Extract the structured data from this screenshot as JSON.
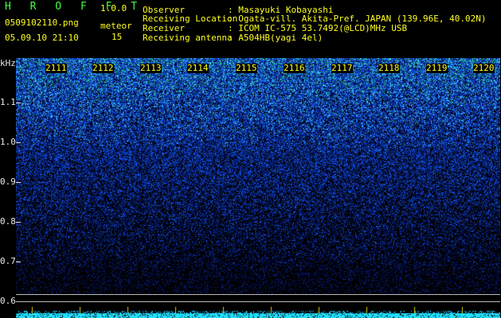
{
  "app": {
    "title": "H R O F F T",
    "version": "1.0.0",
    "filename": "0509102110.png",
    "datetime": "05.09.10 21:10",
    "count_label": "meteor",
    "count_value": "15"
  },
  "info": {
    "observer_label": "Observer",
    "observer_value": ": Masayuki Kobayashi",
    "location_label": "Receiving Location",
    "location_value": ": Ogata-vill. Akita-Pref. JAPAN (139.96E, 40.02N)",
    "receiver_label": "Receiver",
    "receiver_value": ": ICOM IC-575 53.7492(@LCD)MHz USB",
    "antenna_label": "Receiving antenna",
    "antenna_value": ": A504HB(yagi 4el)"
  },
  "spectrogram": {
    "y_unit": "kHz",
    "y_ticks": [
      "1.1",
      "1.0",
      "0.9",
      "0.8",
      "0.7",
      "0.6"
    ],
    "x_ticks": [
      "2111",
      "2112",
      "2113",
      "2114",
      "2115",
      "2116",
      "2117",
      "2118",
      "2119",
      "2120"
    ],
    "colors": {
      "background": "#000000",
      "signal_low": "#0a1a70",
      "signal_mid": "#1050e0",
      "signal_high": "#40d0ff",
      "baseline": "#20e0ff",
      "label": "#ffff20"
    }
  }
}
